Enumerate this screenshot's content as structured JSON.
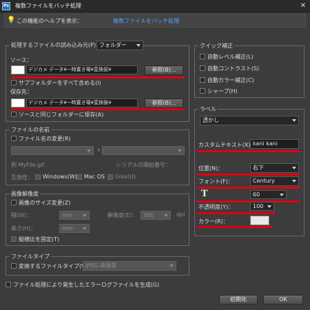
{
  "window": {
    "title": "複数ファイルをバッチ処理",
    "app_icon_text": "Ps"
  },
  "help": {
    "text": "この機能のヘルプを表示：",
    "link": "複数ファイルをバッチ処理"
  },
  "source_group": {
    "title": "処理するファイルの読み込み元(P)：",
    "source_select": "フォルダー",
    "source_label": "ソース：",
    "source_path": "デジカメ データ¥一時置き場¥変換前¥",
    "browse1": "参照(B)...",
    "include_subfolders": "サブフォルダーをすべて含める(I)",
    "dest_label": "保存先：",
    "dest_path": "デジカメ データ¥一時置き場¥変換後¥",
    "browse2": "参照(B)...",
    "same_folder": "ソースと同じフォルダーに保存(A)"
  },
  "filename_group": {
    "title": "ファイルの名前",
    "rename": "ファイル名の変更(R)",
    "plus": "+",
    "example": "例 MyFile.gif",
    "serial_start": "シリアルの開始番号：",
    "compat": "互換性：",
    "windows": "Windows(W)",
    "macos": "Mac OS",
    "unix": "Unix(U)"
  },
  "resize_group": {
    "title": "画像解像度",
    "resize": "画像のサイズ変更(Z)",
    "width_label": "幅(W)：",
    "width_unit": "mm",
    "resolution_label": "解像度(E)：",
    "resolution_value": "300",
    "dpi": "dpi",
    "height_label": "高さ(H)：",
    "height_unit": "mm",
    "constrain": "縦横比を固定(T)"
  },
  "filetype_group": {
    "title": "ファイルタイプ",
    "convert": "変換するファイルタイプ(V)",
    "type_select": "JPEG-高画質"
  },
  "error_log": "ファイル処理により発生したエラーログファイルを生成(G)",
  "quick_fix": {
    "title": "クイック補正",
    "items": [
      "自動レベル補正(L)",
      "自動コントラスト(S)",
      "自動カラー補正(C)",
      "シャープ(H)"
    ]
  },
  "label_group": {
    "title": "ラベル",
    "label_type": "透かし",
    "custom_text_label": "カスタムテキスト(X)：",
    "custom_text_value": "kani kani",
    "position_label": "位置(N)：",
    "position_value": "右下",
    "font_label": "フォント(F)：",
    "font_value": "Century",
    "size_glyph": "T",
    "size_value": "60",
    "opacity_label": "不透明度(Y)：",
    "opacity_value": "100",
    "color_label": "カラー(R)：",
    "color_hex": "#e8e8e8"
  },
  "buttons": {
    "reset": "初期化",
    "ok": "OK"
  }
}
